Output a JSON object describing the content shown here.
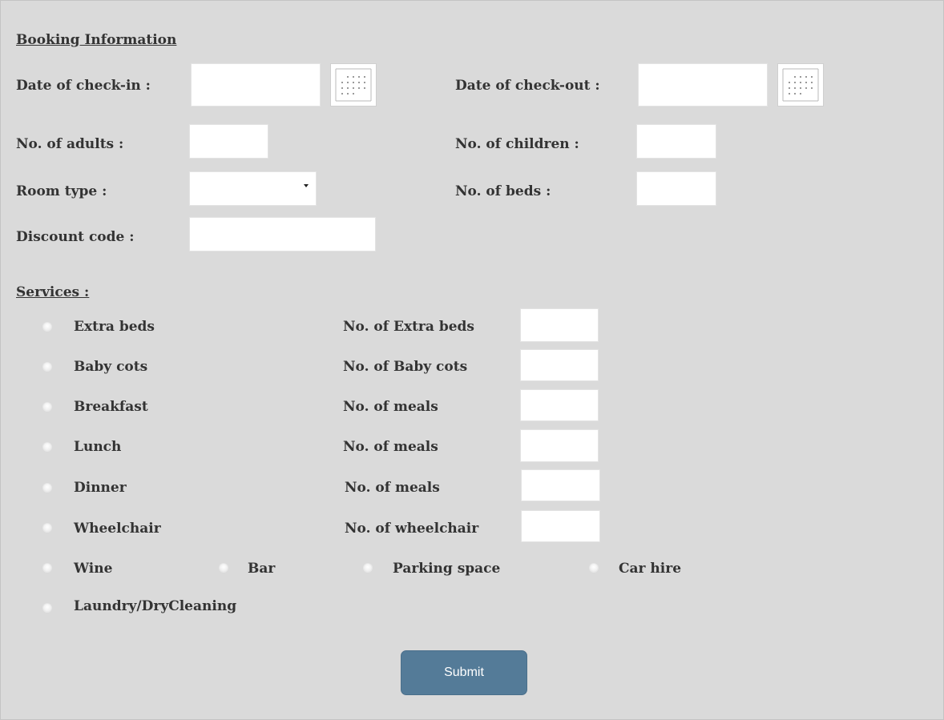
{
  "form": {
    "heading": "Booking Information",
    "checkin_label": "Date of check-in :",
    "checkin_value": "",
    "checkout_label": "Date of check-out :",
    "checkout_value": "",
    "adults_label": "No. of adults :",
    "adults_value": "",
    "children_label": "No. of children :",
    "children_value": "",
    "room_type_label": "Room type :",
    "room_type_selected": "",
    "beds_label": "No. of beds :",
    "beds_value": "",
    "discount_label": "Discount code :",
    "discount_value": ""
  },
  "services": {
    "heading": "Services :",
    "rows": [
      {
        "option": "Extra beds",
        "count_label": "No. of Extra beds",
        "count_value": "",
        "selected": false
      },
      {
        "option": "Baby cots",
        "count_label": "No. of Baby cots",
        "count_value": "",
        "selected": false
      },
      {
        "option": "Breakfast",
        "count_label": "No. of meals",
        "count_value": "",
        "selected": false
      },
      {
        "option": "Lunch",
        "count_label": "No. of meals",
        "count_value": "",
        "selected": false
      },
      {
        "option": "Dinner",
        "count_label": "No. of meals",
        "count_value": "",
        "selected": false
      },
      {
        "option": "Wheelchair",
        "count_label": "No. of wheelchair",
        "count_value": "",
        "selected": false
      }
    ],
    "extras": [
      {
        "option": "Wine",
        "selected": false
      },
      {
        "option": "Bar",
        "selected": false
      },
      {
        "option": "Parking space",
        "selected": false
      },
      {
        "option": "Car hire",
        "selected": false
      },
      {
        "option": "Laundry/DryCleaning",
        "selected": false
      }
    ]
  },
  "submit_label": "Submit",
  "icons": {
    "calendar": "calendar-icon",
    "dropdown": "chevron-down-icon"
  },
  "colors": {
    "background": "#dadada",
    "field": "#ffffff",
    "text": "#333333",
    "submit": "#547b98",
    "submit_text": "#ffffff"
  }
}
